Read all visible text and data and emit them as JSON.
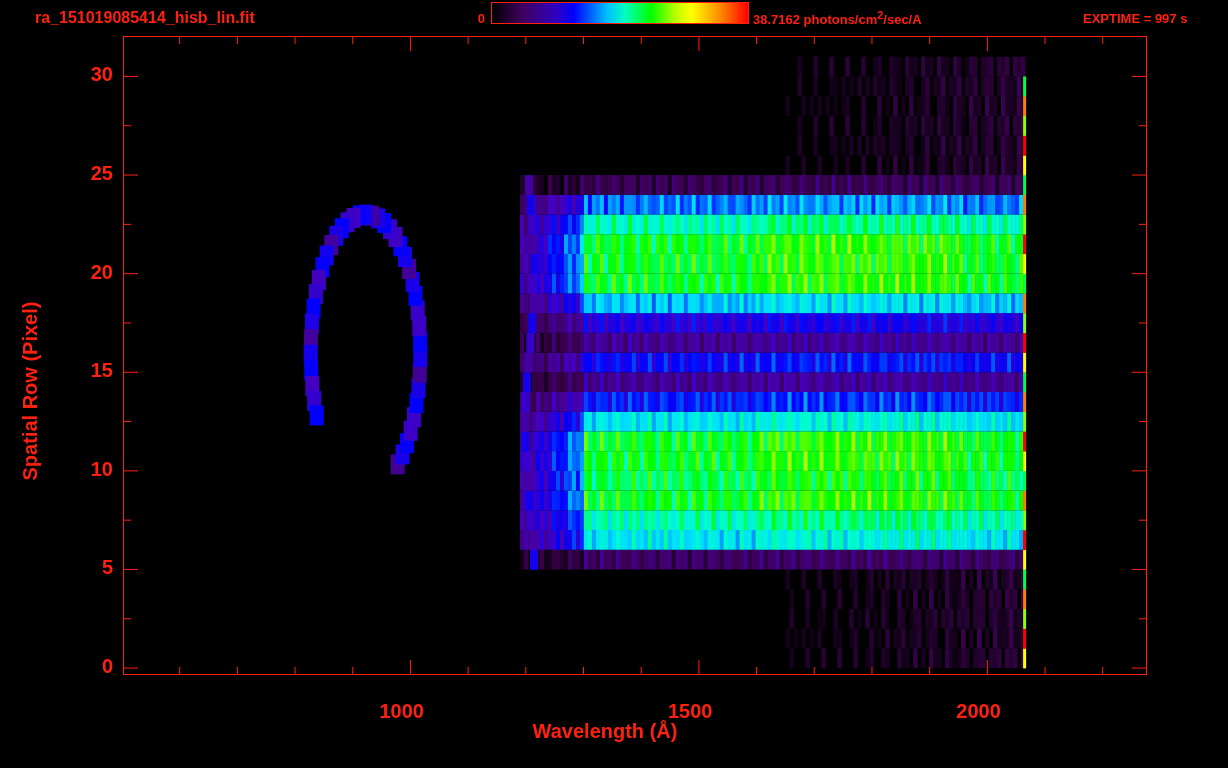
{
  "header": {
    "filename": "ra_151019085414_hisb_lin.fit",
    "colorbar": {
      "min_label": "0",
      "max_label": "38.7162 photons/cm$^{2}$/sec/A"
    },
    "exposure": "EXPTIME = 997 s"
  },
  "plot": {
    "ylabel": "Spatial Row (Pixel)",
    "xlabel": "Wavelength (Å)",
    "xticks": [
      "1000",
      "1500",
      "2000"
    ],
    "yticks": [
      "30",
      "25",
      "20",
      "15",
      "10",
      "5",
      "0"
    ]
  }
}
